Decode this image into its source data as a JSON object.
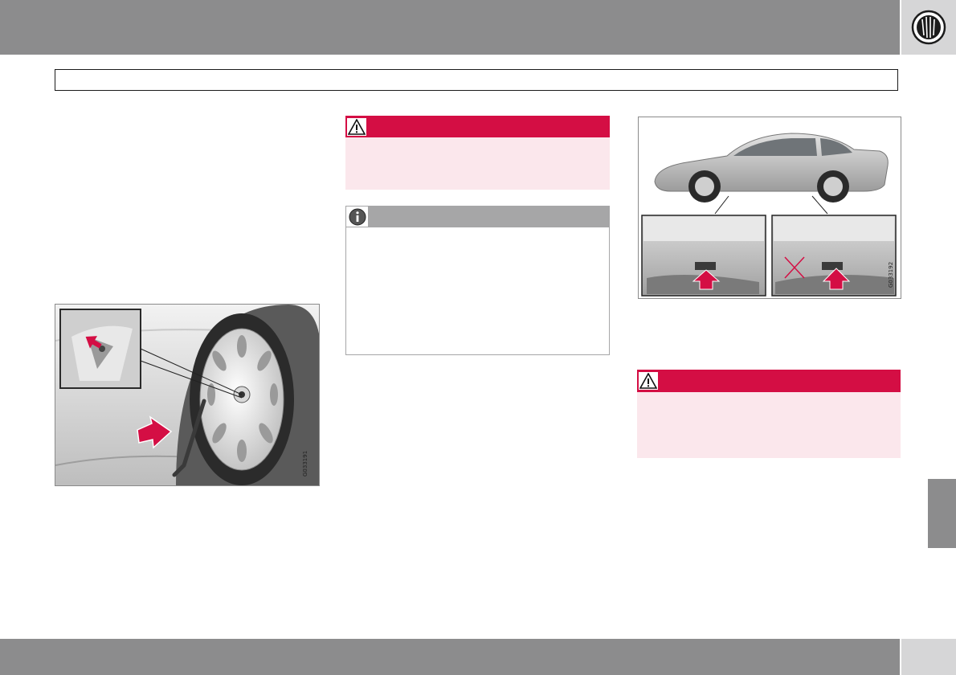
{
  "header": {
    "chapter_icon": "tire-icon",
    "colors": {
      "band": "#8c8c8d",
      "icon_panel": "#d6d6d7"
    }
  },
  "figures": {
    "wheel": {
      "code": "G033191",
      "icon": "wheel-bolt-removal-illustration"
    },
    "car": {
      "code": "G033192",
      "icon": "jack-attachment-points-illustration"
    }
  },
  "warnings": [
    {
      "icon": "warning-triangle-icon"
    },
    {
      "icon": "warning-triangle-icon"
    }
  ],
  "note": {
    "icon": "info-icon"
  },
  "colors": {
    "warning_red": "#d40e44",
    "warning_pink": "#fbe7ec",
    "note_gray": "#a6a6a7"
  }
}
